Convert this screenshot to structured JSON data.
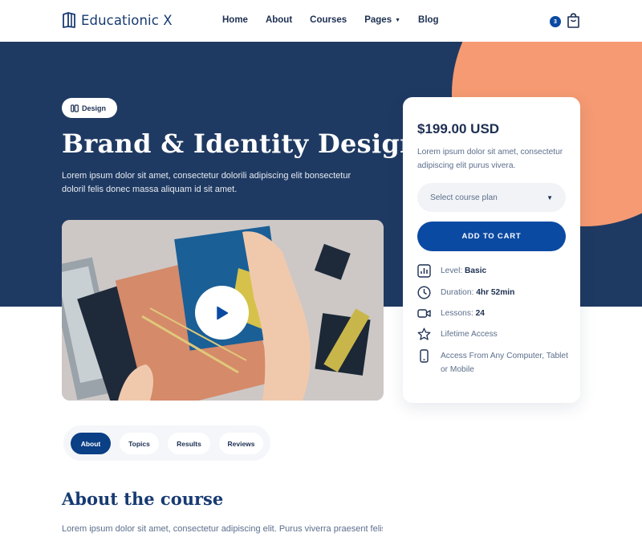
{
  "header": {
    "brand": "Educationic X",
    "nav": [
      {
        "label": "Home"
      },
      {
        "label": "About"
      },
      {
        "label": "Courses"
      },
      {
        "label": "Pages"
      },
      {
        "label": "Blog"
      }
    ],
    "cart_count": "3"
  },
  "hero": {
    "badge": "Design",
    "title": "Brand & Identity Design",
    "description": "Lorem ipsum dolor sit amet, consectetur dolorili adipiscing elit bonsectetur doloril felis donec massa aliquam id sit amet."
  },
  "card": {
    "price": "$199.00 USD",
    "description": "Lorem ipsum dolor sit amet, consectetur adipiscing elit purus vivera.",
    "select_placeholder": "Select course plan",
    "add_to_cart": "ADD TO CART",
    "features": {
      "level_label": "Level:",
      "level_value": "Basic",
      "duration_label": "Duration:",
      "duration_value": "4hr 52min",
      "lessons_label": "Lessons:",
      "lessons_value": "24",
      "lifetime": "Lifetime Access",
      "access": "Access From Any Computer, Tablet or Mobile"
    }
  },
  "tabs": [
    {
      "label": "About"
    },
    {
      "label": "Topics"
    },
    {
      "label": "Results"
    },
    {
      "label": "Reviews"
    }
  ],
  "about": {
    "title": "About the course",
    "text": "Lorem ipsum dolor sit amet, consectetur adipiscing elit. Purus viverra praesent felis"
  },
  "colors": {
    "hero_bg": "#1f3a62",
    "accent": "#0b4aa2",
    "circle": "#f59a72"
  }
}
